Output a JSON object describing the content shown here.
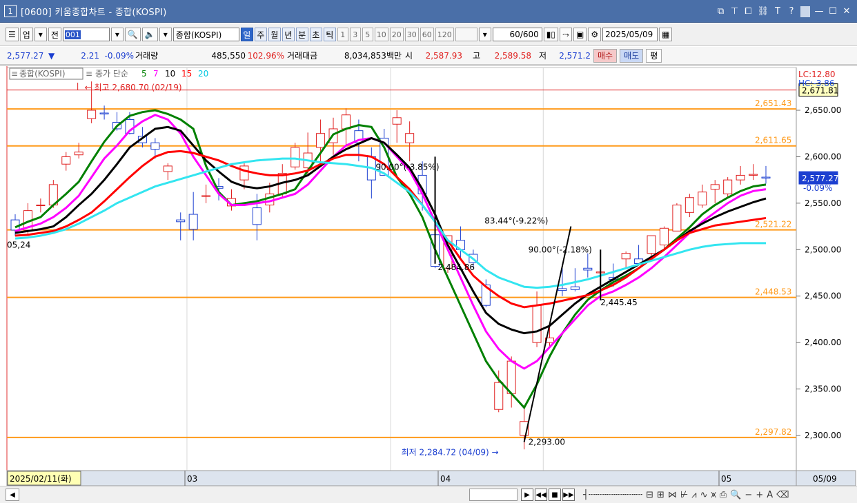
{
  "window": {
    "number": "1",
    "title": "[0600] 키움종합차트 - 종합(KOSPI)",
    "tools": [
      "restore-icon",
      "pin-icon",
      "tile-icon",
      "link-icon",
      "T",
      "?",
      "minimize-icon",
      "maximize-icon",
      "close-icon"
    ]
  },
  "toolbar": {
    "market": "업",
    "all": "전",
    "code": "001",
    "name": "종합(KOSPI)",
    "periods": [
      "일",
      "주",
      "월",
      "년",
      "분",
      "초",
      "틱"
    ],
    "active_period": "일",
    "intervals": [
      "1",
      "3",
      "5",
      "10",
      "20",
      "30",
      "60",
      "120"
    ],
    "count": "60",
    "count_max": "/600",
    "date": "2025/05/09"
  },
  "quote": {
    "price": "2,577.27",
    "arrow": "▼",
    "change": "2.21",
    "change_rate": "-0.09%",
    "volume_label": "거래량",
    "volume": "485,550",
    "volume_ratio": "102.96%",
    "amount_label": "거래대금",
    "amount": "8,034,853백만",
    "open_label": "시",
    "open": "2,587.93",
    "high_label": "고",
    "high": "2,589.58",
    "low_label": "저",
    "low": "2,571.2",
    "buy": "매수",
    "sell": "매도",
    "even": "평"
  },
  "chart": {
    "legend_title": "종합(KOSPI)",
    "legend_ma_label": "종가 단순",
    "ma_periods": [
      {
        "label": "5",
        "color": "#008000"
      },
      {
        "label": "7",
        "color": "#ff00ff"
      },
      {
        "label": "10",
        "color": "#000000"
      },
      {
        "label": "15",
        "color": "#ff0000"
      },
      {
        "label": "20",
        "color": "#00e5ff"
      }
    ],
    "high_note": "최고 2,680.70 (02/19)",
    "low_note": "최저 2,284.72 (04/09)",
    "angle_notes": [
      "90.00°(-3.85%)",
      "83.44°(-9.22%)",
      "90.00°(-2.18%)"
    ],
    "point_labels": [
      "2,484.86",
      "2,293.00",
      "2,445.45",
      "05,24"
    ],
    "h_levels": [
      "2,651.43",
      "2,611.65",
      "2,521.22",
      "2,448.53",
      "2,297.82"
    ],
    "right_labels": [
      "LC:12.80",
      "HC:-3.86"
    ],
    "red_level": "2,671.81",
    "current_price": "2,577.27",
    "current_rate": "-0.09%",
    "y_ticks": [
      "2,650.00",
      "2,600.00",
      "2,550.00",
      "2,500.00",
      "2,450.00",
      "2,400.00",
      "2,350.00",
      "2,300.00"
    ],
    "x_labels": [
      "2025/02/11(화)",
      "03",
      "04",
      "05"
    ],
    "x_end": "05/09"
  },
  "chart_data": {
    "type": "candlestick",
    "title": "종합(KOSPI)",
    "ylim": [
      2280,
      2670
    ],
    "x": [
      "02/11",
      "02/12",
      "02/13",
      "02/14",
      "02/17",
      "02/18",
      "02/19",
      "02/20",
      "02/21",
      "02/24",
      "02/25",
      "02/26",
      "02/27",
      "02/28",
      "03/04",
      "03/05",
      "03/06",
      "03/07",
      "03/10",
      "03/11",
      "03/12",
      "03/13",
      "03/14",
      "03/17",
      "03/18",
      "03/19",
      "03/20",
      "03/21",
      "03/24",
      "03/25",
      "03/26",
      "03/27",
      "03/28",
      "03/31",
      "04/01",
      "04/02",
      "04/03",
      "04/04",
      "04/07",
      "04/08",
      "04/09",
      "04/10",
      "04/11",
      "04/14",
      "04/15",
      "04/16",
      "04/17",
      "04/18",
      "04/21",
      "04/22",
      "04/23",
      "04/24",
      "04/25",
      "04/28",
      "04/29",
      "04/30",
      "05/02",
      "05/07",
      "05/08",
      "05/09"
    ],
    "open": [
      2532,
      2521,
      2548,
      2548,
      2592,
      2602,
      2641,
      2647,
      2637,
      2640,
      2622,
      2615,
      2584,
      2532,
      2538,
      2558,
      2568,
      2547,
      2575,
      2545,
      2548,
      2560,
      2589,
      2588,
      2610,
      2615,
      2630,
      2628,
      2600,
      2620,
      2635,
      2615,
      2580,
      2516,
      2480,
      2510,
      2495,
      2462,
      2328,
      2345,
      2300,
      2400,
      2400,
      2458,
      2460,
      2480,
      2475,
      2470,
      2490,
      2490,
      2496,
      2505,
      2520,
      2540,
      2548,
      2565,
      2560,
      2575,
      2580,
      2578
    ],
    "high": [
      2538,
      2550,
      2555,
      2575,
      2605,
      2615,
      2681,
      2655,
      2648,
      2648,
      2632,
      2620,
      2593,
      2540,
      2562,
      2570,
      2577,
      2565,
      2595,
      2560,
      2572,
      2592,
      2615,
      2626,
      2640,
      2642,
      2652,
      2640,
      2610,
      2630,
      2650,
      2638,
      2595,
      2520,
      2510,
      2525,
      2500,
      2468,
      2370,
      2385,
      2330,
      2455,
      2420,
      2480,
      2480,
      2496,
      2490,
      2485,
      2498,
      2505,
      2515,
      2525,
      2550,
      2560,
      2570,
      2575,
      2578,
      2590,
      2592,
      2590
    ],
    "low": [
      2515,
      2515,
      2540,
      2545,
      2585,
      2598,
      2636,
      2640,
      2628,
      2624,
      2610,
      2598,
      2575,
      2510,
      2510,
      2550,
      2553,
      2542,
      2565,
      2510,
      2540,
      2555,
      2586,
      2580,
      2595,
      2602,
      2612,
      2595,
      2555,
      2580,
      2615,
      2595,
      2542,
      2480,
      2475,
      2490,
      2480,
      2438,
      2325,
      2330,
      2285,
      2395,
      2395,
      2450,
      2455,
      2470,
      2465,
      2460,
      2480,
      2485,
      2490,
      2500,
      2520,
      2535,
      2545,
      2550,
      2555,
      2570,
      2575,
      2571
    ],
    "close": [
      2521,
      2542,
      2548,
      2570,
      2600,
      2605,
      2650,
      2646,
      2630,
      2625,
      2615,
      2608,
      2590,
      2530,
      2522,
      2558,
      2566,
      2555,
      2590,
      2527,
      2560,
      2582,
      2610,
      2604,
      2625,
      2630,
      2645,
      2615,
      2575,
      2580,
      2642,
      2625,
      2560,
      2482,
      2515,
      2500,
      2486,
      2440,
      2357,
      2380,
      2315,
      2440,
      2405,
      2456,
      2457,
      2478,
      2476,
      2468,
      2496,
      2485,
      2515,
      2523,
      2548,
      2556,
      2562,
      2570,
      2575,
      2580,
      2581,
      2577
    ],
    "series": [
      {
        "name": "5",
        "values": [
          2524,
          2530,
          2535,
          2548,
          2560,
          2573,
          2595,
          2616,
          2633,
          2644,
          2648,
          2650,
          2646,
          2640,
          2630,
          2590,
          2562,
          2548,
          2550,
          2552,
          2556,
          2560,
          2565,
          2585,
          2604,
          2624,
          2630,
          2634,
          2632,
          2610,
          2578,
          2560,
          2535,
          2500,
          2470,
          2440,
          2410,
          2380,
          2360,
          2345,
          2330,
          2355,
          2385,
          2410,
          2430,
          2446,
          2456,
          2465,
          2472,
          2480,
          2490,
          2500,
          2512,
          2524,
          2538,
          2548,
          2556,
          2563,
          2568,
          2570
        ]
      },
      {
        "name": "7",
        "values": [
          2520,
          2524,
          2528,
          2535,
          2545,
          2558,
          2578,
          2598,
          2612,
          2628,
          2638,
          2645,
          2640,
          2625,
          2600,
          2580,
          2560,
          2548,
          2548,
          2550,
          2552,
          2556,
          2560,
          2570,
          2585,
          2600,
          2612,
          2618,
          2620,
          2615,
          2600,
          2585,
          2560,
          2530,
          2500,
          2470,
          2440,
          2412,
          2393,
          2380,
          2372,
          2380,
          2395,
          2410,
          2425,
          2440,
          2450,
          2455,
          2462,
          2470,
          2480,
          2492,
          2505,
          2518,
          2530,
          2540,
          2550,
          2558,
          2563,
          2565
        ]
      },
      {
        "name": "10",
        "values": [
          2518,
          2520,
          2522,
          2525,
          2535,
          2548,
          2560,
          2575,
          2592,
          2610,
          2620,
          2630,
          2632,
          2628,
          2612,
          2596,
          2584,
          2573,
          2568,
          2566,
          2568,
          2572,
          2575,
          2580,
          2590,
          2600,
          2608,
          2614,
          2620,
          2615,
          2602,
          2588,
          2565,
          2538,
          2505,
          2480,
          2455,
          2432,
          2420,
          2414,
          2410,
          2412,
          2418,
          2430,
          2442,
          2452,
          2460,
          2468,
          2476,
          2484,
          2492,
          2500,
          2510,
          2520,
          2528,
          2535,
          2541,
          2546,
          2551,
          2555
        ]
      },
      {
        "name": "15",
        "values": [
          2515,
          2516,
          2518,
          2520,
          2525,
          2532,
          2540,
          2552,
          2565,
          2578,
          2590,
          2600,
          2605,
          2606,
          2604,
          2600,
          2596,
          2590,
          2585,
          2582,
          2580,
          2580,
          2582,
          2585,
          2592,
          2598,
          2602,
          2602,
          2600,
          2592,
          2578,
          2565,
          2548,
          2530,
          2510,
          2490,
          2472,
          2460,
          2450,
          2442,
          2438,
          2440,
          2442,
          2445,
          2448,
          2451,
          2456,
          2462,
          2470,
          2480,
          2490,
          2500,
          2510,
          2518,
          2522,
          2526,
          2528,
          2530,
          2532,
          2534
        ]
      },
      {
        "name": "20",
        "values": [
          2512,
          2513,
          2515,
          2518,
          2522,
          2528,
          2535,
          2542,
          2550,
          2556,
          2562,
          2568,
          2572,
          2576,
          2580,
          2584,
          2588,
          2592,
          2594,
          2596,
          2597,
          2598,
          2598,
          2596,
          2594,
          2593,
          2592,
          2590,
          2588,
          2582,
          2572,
          2562,
          2548,
          2530,
          2510,
          2500,
          2490,
          2478,
          2470,
          2465,
          2460,
          2459,
          2460,
          2462,
          2465,
          2468,
          2472,
          2476,
          2480,
          2484,
          2488,
          2492,
          2496,
          2500,
          2503,
          2505,
          2506,
          2507,
          2507,
          2507
        ]
      }
    ]
  }
}
